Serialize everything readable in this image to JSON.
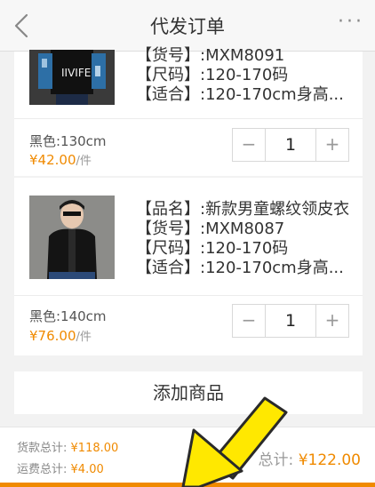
{
  "nav": {
    "title": "代发订单",
    "more": "···"
  },
  "items": [
    {
      "name_row": "",
      "sku_row": "【货号】:MXM8091",
      "size_row": "【尺码】:120-170码",
      "fit_row": "【适合】:120-170cm身高...",
      "variant": "黑色:130cm",
      "price_symbol": "¥",
      "price_int": "42",
      "price_dec": ".00",
      "price_unit": "/件",
      "qty": "1",
      "minus": "−",
      "plus": "+"
    },
    {
      "name_row": "【品名】:新款男童螺纹领皮衣",
      "sku_row": "【货号】:MXM8087",
      "size_row": "【尺码】:120-170码",
      "fit_row": "【适合】:120-170cm身高...",
      "variant": "黑色:140cm",
      "price_symbol": "¥",
      "price_int": "76",
      "price_dec": ".00",
      "price_unit": "/件",
      "qty": "1",
      "minus": "−",
      "plus": "+"
    }
  ],
  "add_button": "添加商品",
  "footer": {
    "goods_label": "货款总计:",
    "goods_value": "¥118.00",
    "shipping_label": "运费总计:",
    "shipping_value": "¥4.00",
    "total_label": "总计:",
    "total_value": "¥122.00"
  },
  "colors": {
    "accent": "#f08a00",
    "arrow": "#ffe800"
  },
  "icons": {
    "back": "back-chevron-icon",
    "more": "more-dots-icon"
  }
}
